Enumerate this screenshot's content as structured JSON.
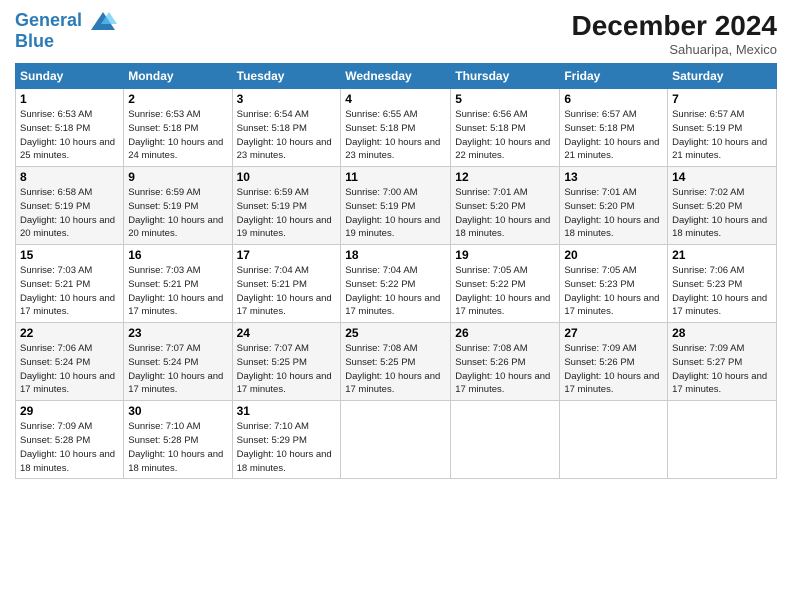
{
  "header": {
    "logo_line1": "General",
    "logo_line2": "Blue",
    "month": "December 2024",
    "location": "Sahuaripa, Mexico"
  },
  "weekdays": [
    "Sunday",
    "Monday",
    "Tuesday",
    "Wednesday",
    "Thursday",
    "Friday",
    "Saturday"
  ],
  "weeks": [
    [
      {
        "day": "1",
        "sunrise": "6:53 AM",
        "sunset": "5:18 PM",
        "daylight": "10 hours and 25 minutes."
      },
      {
        "day": "2",
        "sunrise": "6:53 AM",
        "sunset": "5:18 PM",
        "daylight": "10 hours and 24 minutes."
      },
      {
        "day": "3",
        "sunrise": "6:54 AM",
        "sunset": "5:18 PM",
        "daylight": "10 hours and 23 minutes."
      },
      {
        "day": "4",
        "sunrise": "6:55 AM",
        "sunset": "5:18 PM",
        "daylight": "10 hours and 23 minutes."
      },
      {
        "day": "5",
        "sunrise": "6:56 AM",
        "sunset": "5:18 PM",
        "daylight": "10 hours and 22 minutes."
      },
      {
        "day": "6",
        "sunrise": "6:57 AM",
        "sunset": "5:18 PM",
        "daylight": "10 hours and 21 minutes."
      },
      {
        "day": "7",
        "sunrise": "6:57 AM",
        "sunset": "5:19 PM",
        "daylight": "10 hours and 21 minutes."
      }
    ],
    [
      {
        "day": "8",
        "sunrise": "6:58 AM",
        "sunset": "5:19 PM",
        "daylight": "10 hours and 20 minutes."
      },
      {
        "day": "9",
        "sunrise": "6:59 AM",
        "sunset": "5:19 PM",
        "daylight": "10 hours and 20 minutes."
      },
      {
        "day": "10",
        "sunrise": "6:59 AM",
        "sunset": "5:19 PM",
        "daylight": "10 hours and 19 minutes."
      },
      {
        "day": "11",
        "sunrise": "7:00 AM",
        "sunset": "5:19 PM",
        "daylight": "10 hours and 19 minutes."
      },
      {
        "day": "12",
        "sunrise": "7:01 AM",
        "sunset": "5:20 PM",
        "daylight": "10 hours and 18 minutes."
      },
      {
        "day": "13",
        "sunrise": "7:01 AM",
        "sunset": "5:20 PM",
        "daylight": "10 hours and 18 minutes."
      },
      {
        "day": "14",
        "sunrise": "7:02 AM",
        "sunset": "5:20 PM",
        "daylight": "10 hours and 18 minutes."
      }
    ],
    [
      {
        "day": "15",
        "sunrise": "7:03 AM",
        "sunset": "5:21 PM",
        "daylight": "10 hours and 17 minutes."
      },
      {
        "day": "16",
        "sunrise": "7:03 AM",
        "sunset": "5:21 PM",
        "daylight": "10 hours and 17 minutes."
      },
      {
        "day": "17",
        "sunrise": "7:04 AM",
        "sunset": "5:21 PM",
        "daylight": "10 hours and 17 minutes."
      },
      {
        "day": "18",
        "sunrise": "7:04 AM",
        "sunset": "5:22 PM",
        "daylight": "10 hours and 17 minutes."
      },
      {
        "day": "19",
        "sunrise": "7:05 AM",
        "sunset": "5:22 PM",
        "daylight": "10 hours and 17 minutes."
      },
      {
        "day": "20",
        "sunrise": "7:05 AM",
        "sunset": "5:23 PM",
        "daylight": "10 hours and 17 minutes."
      },
      {
        "day": "21",
        "sunrise": "7:06 AM",
        "sunset": "5:23 PM",
        "daylight": "10 hours and 17 minutes."
      }
    ],
    [
      {
        "day": "22",
        "sunrise": "7:06 AM",
        "sunset": "5:24 PM",
        "daylight": "10 hours and 17 minutes."
      },
      {
        "day": "23",
        "sunrise": "7:07 AM",
        "sunset": "5:24 PM",
        "daylight": "10 hours and 17 minutes."
      },
      {
        "day": "24",
        "sunrise": "7:07 AM",
        "sunset": "5:25 PM",
        "daylight": "10 hours and 17 minutes."
      },
      {
        "day": "25",
        "sunrise": "7:08 AM",
        "sunset": "5:25 PM",
        "daylight": "10 hours and 17 minutes."
      },
      {
        "day": "26",
        "sunrise": "7:08 AM",
        "sunset": "5:26 PM",
        "daylight": "10 hours and 17 minutes."
      },
      {
        "day": "27",
        "sunrise": "7:09 AM",
        "sunset": "5:26 PM",
        "daylight": "10 hours and 17 minutes."
      },
      {
        "day": "28",
        "sunrise": "7:09 AM",
        "sunset": "5:27 PM",
        "daylight": "10 hours and 17 minutes."
      }
    ],
    [
      {
        "day": "29",
        "sunrise": "7:09 AM",
        "sunset": "5:28 PM",
        "daylight": "10 hours and 18 minutes."
      },
      {
        "day": "30",
        "sunrise": "7:10 AM",
        "sunset": "5:28 PM",
        "daylight": "10 hours and 18 minutes."
      },
      {
        "day": "31",
        "sunrise": "7:10 AM",
        "sunset": "5:29 PM",
        "daylight": "10 hours and 18 minutes."
      },
      null,
      null,
      null,
      null
    ]
  ]
}
